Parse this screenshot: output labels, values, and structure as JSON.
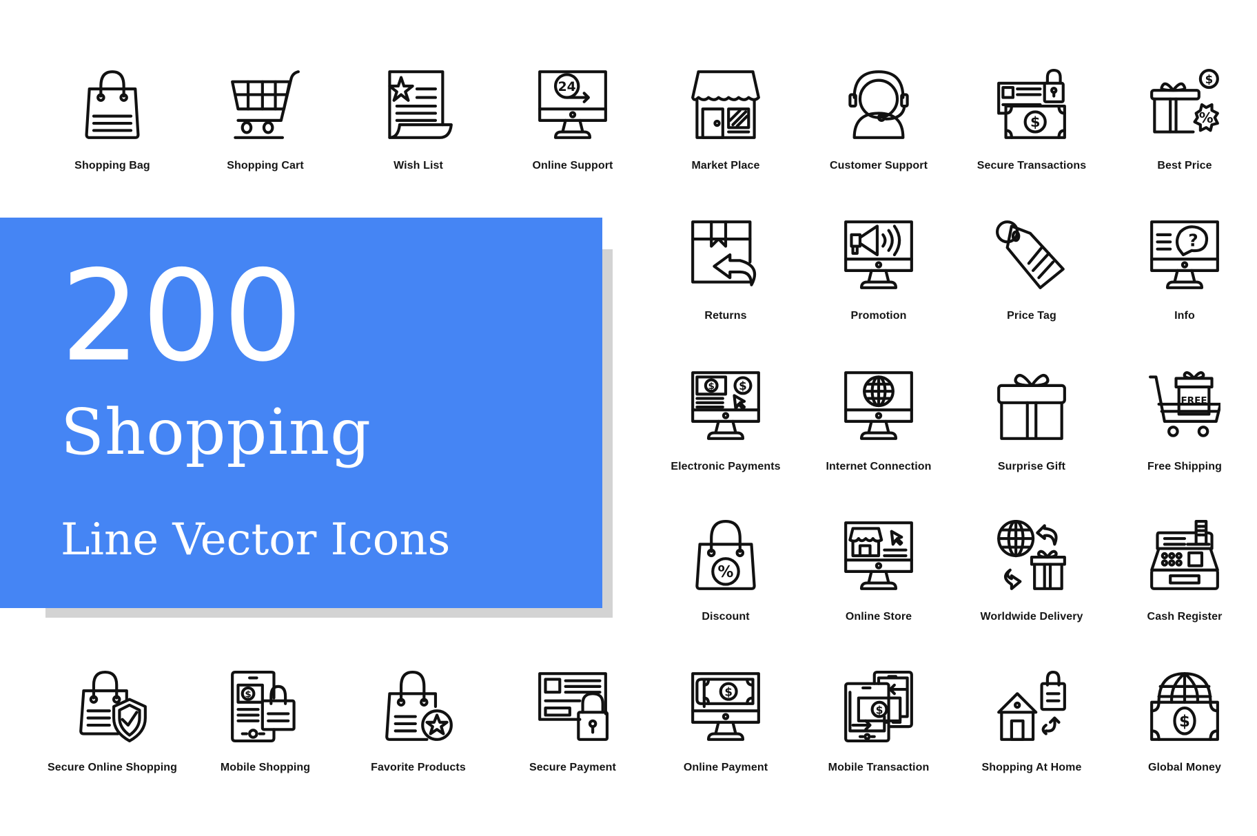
{
  "banner": {
    "count": "200",
    "title": "Shopping",
    "subtitle": "Line Vector Icons",
    "background_color": "#4585f4",
    "shadow_color": "#d3d3d3",
    "text_color": "#ffffff"
  },
  "icons": [
    {
      "label": "Shopping Bag",
      "icon": "shopping-bag-icon"
    },
    {
      "label": "Shopping Cart",
      "icon": "shopping-cart-icon"
    },
    {
      "label": "Wish List",
      "icon": "wish-list-icon"
    },
    {
      "label": "Online Support",
      "icon": "online-support-icon"
    },
    {
      "label": "Market Place",
      "icon": "market-place-icon"
    },
    {
      "label": "Customer Support",
      "icon": "customer-support-icon"
    },
    {
      "label": "Secure Transactions",
      "icon": "secure-transactions-icon"
    },
    {
      "label": "Best Price",
      "icon": "best-price-icon"
    },
    {
      "label": "Returns",
      "icon": "returns-icon"
    },
    {
      "label": "Promotion",
      "icon": "promotion-icon"
    },
    {
      "label": "Price Tag",
      "icon": "price-tag-icon"
    },
    {
      "label": "Info",
      "icon": "info-icon"
    },
    {
      "label": "Electronic Payments",
      "icon": "electronic-payments-icon"
    },
    {
      "label": "Internet Connection",
      "icon": "internet-connection-icon"
    },
    {
      "label": "Surprise Gift",
      "icon": "surprise-gift-icon"
    },
    {
      "label": "Free Shipping",
      "icon": "free-shipping-icon"
    },
    {
      "label": "Discount",
      "icon": "discount-icon"
    },
    {
      "label": "Online Store",
      "icon": "online-store-icon"
    },
    {
      "label": "Worldwide Delivery",
      "icon": "worldwide-delivery-icon"
    },
    {
      "label": "Cash Register",
      "icon": "cash-register-icon"
    },
    {
      "label": "Secure Online Shopping",
      "icon": "secure-online-shopping-icon"
    },
    {
      "label": "Mobile Shopping",
      "icon": "mobile-shopping-icon"
    },
    {
      "label": "Favorite Products",
      "icon": "favorite-products-icon"
    },
    {
      "label": "Secure Payment",
      "icon": "secure-payment-icon"
    },
    {
      "label": "Online Payment",
      "icon": "online-payment-icon"
    },
    {
      "label": "Mobile Transaction",
      "icon": "mobile-transaction-icon"
    },
    {
      "label": "Shopping At Home",
      "icon": "shopping-at-home-icon"
    },
    {
      "label": "Global Money",
      "icon": "global-money-icon"
    }
  ],
  "icon_text": {
    "support_hours": "24",
    "free_badge": "FREE",
    "dollar": "$",
    "percent": "%",
    "question": "?"
  }
}
